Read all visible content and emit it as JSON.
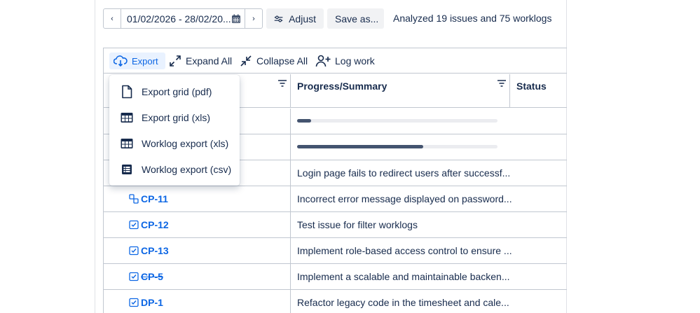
{
  "toolbar": {
    "prev_label": "‹",
    "next_label": "›",
    "date_range": "01/02/2026 - 28/02/20...",
    "adjust_label": "Adjust",
    "save_as_label": "Save as...",
    "analyzed_text": "Analyzed 19 issues and 75 worklogs"
  },
  "grid_toolbar": {
    "export_label": "Export",
    "expand_all_label": "Expand All",
    "collapse_all_label": "Collapse All",
    "log_work_label": "Log work"
  },
  "columns": [
    {
      "title": ""
    },
    {
      "title": "Progress/Summary"
    },
    {
      "title": "Status"
    }
  ],
  "export_menu": [
    {
      "label": "Export grid (pdf)",
      "icon": "file-icon"
    },
    {
      "label": "Export grid (xls)",
      "icon": "table-icon"
    },
    {
      "label": "Worklog export (xls)",
      "icon": "table-icon"
    },
    {
      "label": "Worklog export (csv)",
      "icon": "csv-icon"
    }
  ],
  "rows": [
    {
      "progress": 0.07
    },
    {
      "progress": 0.63
    },
    {
      "summary": "Login page fails to redirect users after successf..."
    },
    {
      "key": "CP-11",
      "icon": "subtask-icon",
      "summary": "Incorrect error message displayed on password..."
    },
    {
      "key": "CP-12",
      "icon": "task-icon",
      "summary": "Test issue for filter worklogs"
    },
    {
      "key": "CP-13",
      "icon": "task-icon",
      "summary": "Implement role-based access control to ensure ..."
    },
    {
      "key": "CP-5",
      "icon": "task-icon",
      "done": true,
      "summary": "Implement a scalable and maintainable backen..."
    },
    {
      "key": "DP-1",
      "icon": "task-icon",
      "summary": "Refactor legacy code in the timesheet and cale..."
    }
  ],
  "colors": {
    "link": "#0c66e4",
    "text": "#172b4d",
    "progress": "#44546f",
    "export_bg": "#e9f2ff"
  }
}
